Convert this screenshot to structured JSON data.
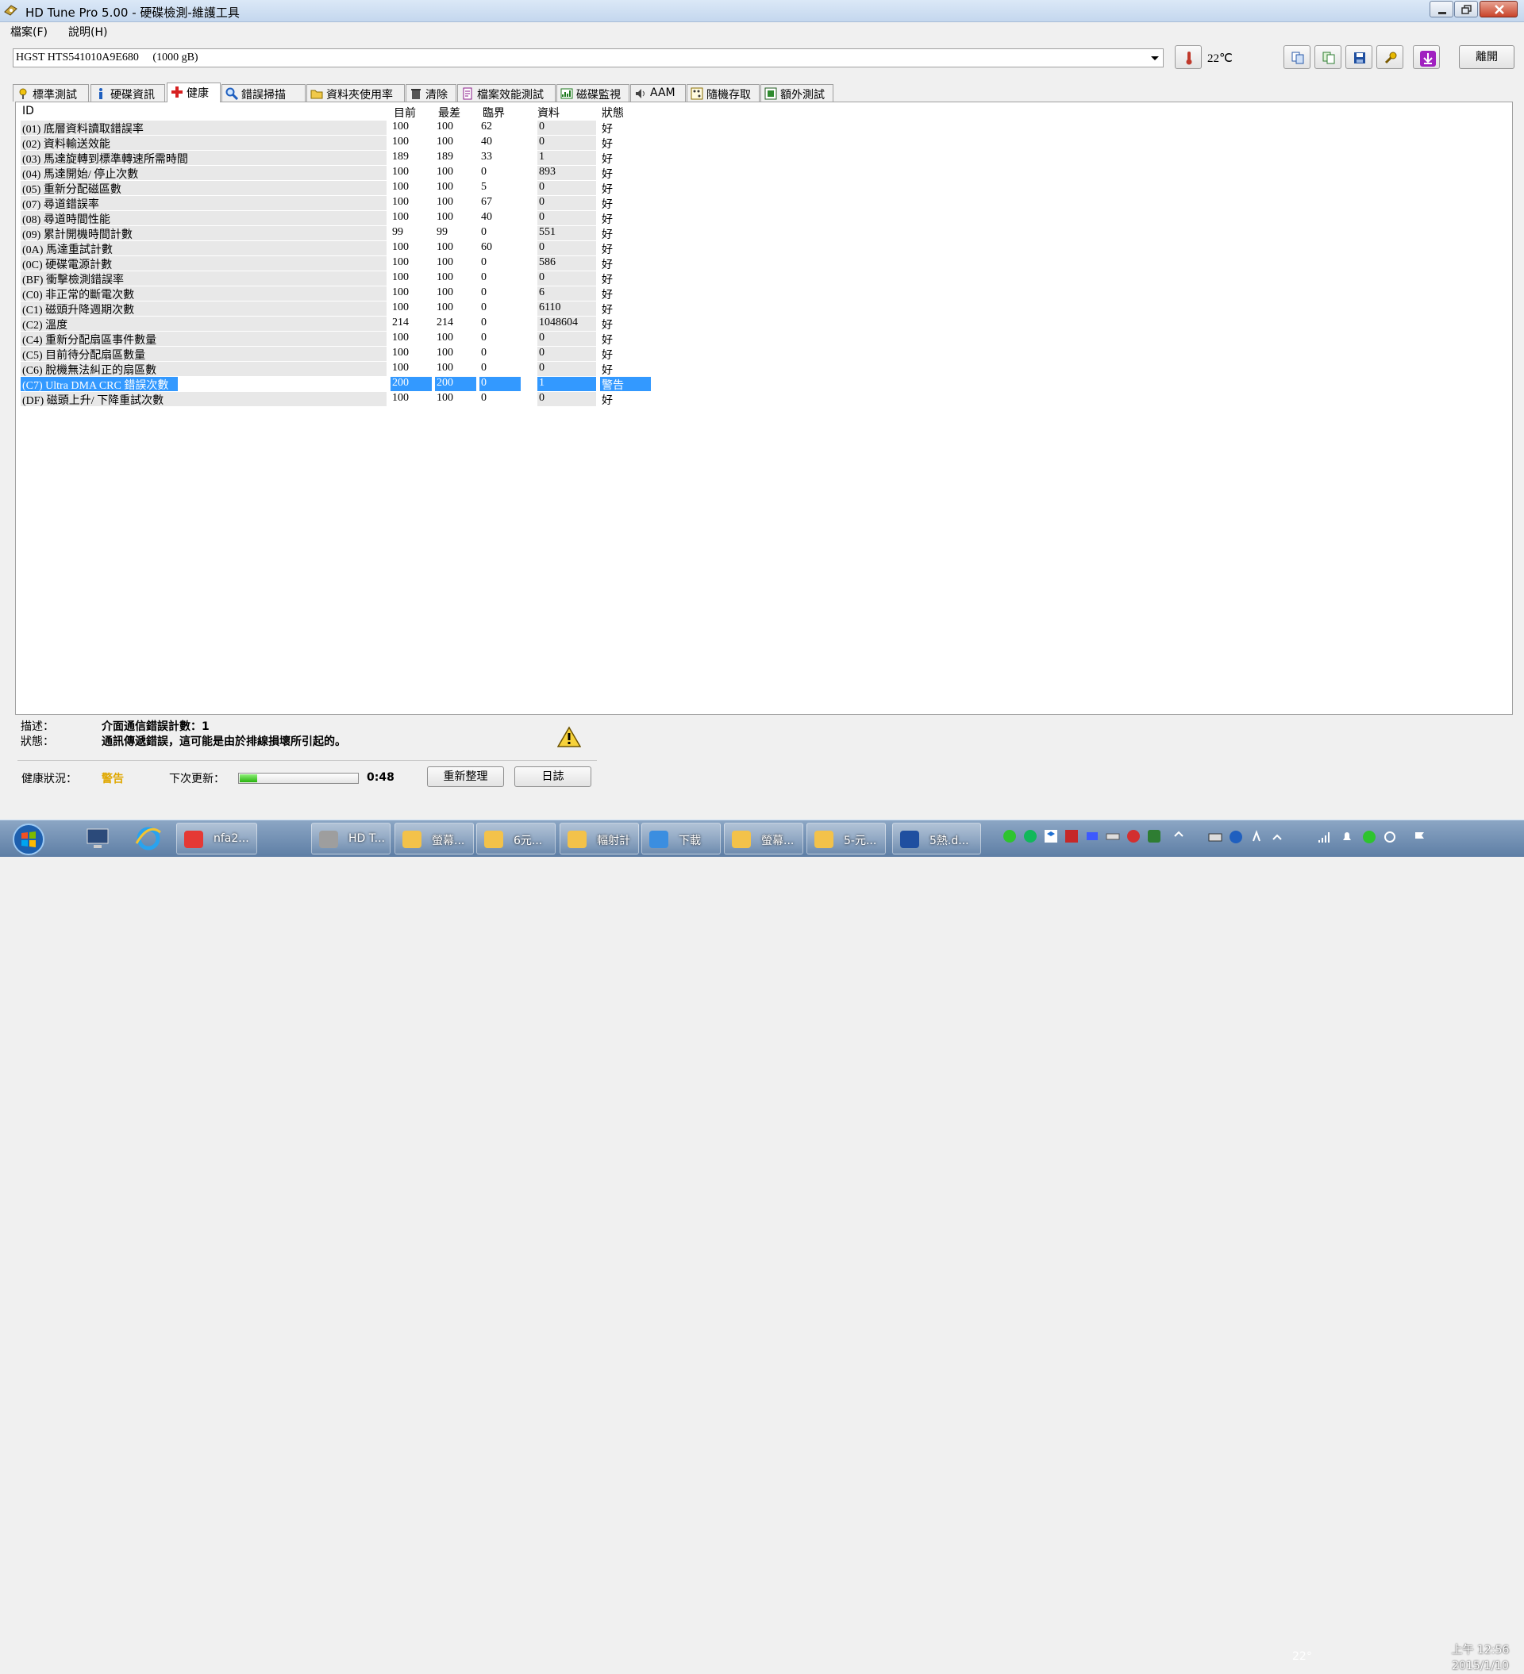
{
  "window": {
    "title": "HD Tune Pro  5.00 - 硬碟檢測-維護工具"
  },
  "menu": {
    "file": "檔案(F)",
    "help": "說明(H)"
  },
  "toolbar": {
    "drive": "HGST HTS541010A9E680     (1000 gB)",
    "temperature": "22℃",
    "exit_label": "離開"
  },
  "tabs": [
    {
      "label": "標準測試",
      "icon": "benchmark-icon"
    },
    {
      "label": "硬碟資訊",
      "icon": "info-icon"
    },
    {
      "label": "健康",
      "icon": "health-cross-icon"
    },
    {
      "label": "錯誤掃描",
      "icon": "magnifier-icon"
    },
    {
      "label": "資料夾使用率",
      "icon": "folder-icon"
    },
    {
      "label": "清除",
      "icon": "trash-icon"
    },
    {
      "label": "檔案效能測試",
      "icon": "file-icon"
    },
    {
      "label": "磁碟監視",
      "icon": "monitor-icon"
    },
    {
      "label": "AAM",
      "icon": "speaker-icon"
    },
    {
      "label": "隨機存取",
      "icon": "random-icon"
    },
    {
      "label": "額外測試",
      "icon": "extra-icon"
    }
  ],
  "active_tab": "健康",
  "health": {
    "headers": {
      "id": "ID",
      "current": "目前",
      "worst": "最差",
      "threshold": "臨界",
      "data": "資料",
      "status": "狀態"
    },
    "rows": [
      {
        "id": "(01) 底層資料讀取錯誤率",
        "current": "100",
        "worst": "100",
        "threshold": "62",
        "data": "0",
        "status": "好"
      },
      {
        "id": "(02) 資料輸送效能",
        "current": "100",
        "worst": "100",
        "threshold": "40",
        "data": "0",
        "status": "好"
      },
      {
        "id": "(03) 馬達旋轉到標準轉速所需時間",
        "current": "189",
        "worst": "189",
        "threshold": "33",
        "data": "1",
        "status": "好"
      },
      {
        "id": "(04) 馬達開始/ 停止次數",
        "current": "100",
        "worst": "100",
        "threshold": "0",
        "data": "893",
        "status": "好"
      },
      {
        "id": "(05) 重新分配磁區數",
        "current": "100",
        "worst": "100",
        "threshold": "5",
        "data": "0",
        "status": "好"
      },
      {
        "id": "(07) 尋道錯誤率",
        "current": "100",
        "worst": "100",
        "threshold": "67",
        "data": "0",
        "status": "好"
      },
      {
        "id": "(08) 尋道時間性能",
        "current": "100",
        "worst": "100",
        "threshold": "40",
        "data": "0",
        "status": "好"
      },
      {
        "id": "(09) 累計開機時間計數",
        "current": "99",
        "worst": "99",
        "threshold": "0",
        "data": "551",
        "status": "好"
      },
      {
        "id": "(0A) 馬達重試計數",
        "current": "100",
        "worst": "100",
        "threshold": "60",
        "data": "0",
        "status": "好"
      },
      {
        "id": "(0C) 硬碟電源計數",
        "current": "100",
        "worst": "100",
        "threshold": "0",
        "data": "586",
        "status": "好"
      },
      {
        "id": "(BF) 衝擊檢測錯誤率",
        "current": "100",
        "worst": "100",
        "threshold": "0",
        "data": "0",
        "status": "好"
      },
      {
        "id": "(C0) 非正常的斷電次數",
        "current": "100",
        "worst": "100",
        "threshold": "0",
        "data": "6",
        "status": "好"
      },
      {
        "id": "(C1) 磁頭升降週期次數",
        "current": "100",
        "worst": "100",
        "threshold": "0",
        "data": "6110",
        "status": "好"
      },
      {
        "id": "(C2) 溫度",
        "current": "214",
        "worst": "214",
        "threshold": "0",
        "data": "1048604",
        "status": "好"
      },
      {
        "id": "(C4) 重新分配扇區事件數量",
        "current": "100",
        "worst": "100",
        "threshold": "0",
        "data": "0",
        "status": "好"
      },
      {
        "id": "(C5) 目前待分配扇區數量",
        "current": "100",
        "worst": "100",
        "threshold": "0",
        "data": "0",
        "status": "好"
      },
      {
        "id": "(C6) 脫機無法糾正的扇區數",
        "current": "100",
        "worst": "100",
        "threshold": "0",
        "data": "0",
        "status": "好"
      },
      {
        "id": "(C7) Ultra DMA CRC 錯誤次數",
        "current": "200",
        "worst": "200",
        "threshold": "0",
        "data": "1",
        "status": "警告"
      },
      {
        "id": "(DF) 磁頭上升/ 下降重試次數",
        "current": "100",
        "worst": "100",
        "threshold": "0",
        "data": "0",
        "status": "好"
      }
    ],
    "selected_row": 17
  },
  "details": {
    "desc_label": "描述：",
    "desc_value": "介面通信錯誤計數：1",
    "status_label": "狀態：",
    "status_value": "通訊傳遞錯誤，這可能是由於排線損壞所引起的。",
    "health_label": "健康狀況：",
    "health_value": "警告",
    "health_color": "#e0a800",
    "next_update_label": "下次更新：",
    "countdown": "0:48",
    "progress_fraction": 0.15,
    "refresh_label": "重新整理",
    "log_label": "日誌"
  },
  "taskbar": {
    "items": [
      {
        "label": "nfa2..."
      },
      {
        "label": "HD T..."
      },
      {
        "label": "螢幕..."
      },
      {
        "label": "6元..."
      },
      {
        "label": "輻射計"
      },
      {
        "label": "下載"
      },
      {
        "label": "螢幕..."
      },
      {
        "label": "5-元..."
      },
      {
        "label": "5熱.d..."
      }
    ],
    "tray_temp": "22°",
    "clock_time": "上午 12:56",
    "clock_date": "2015/1/10"
  }
}
